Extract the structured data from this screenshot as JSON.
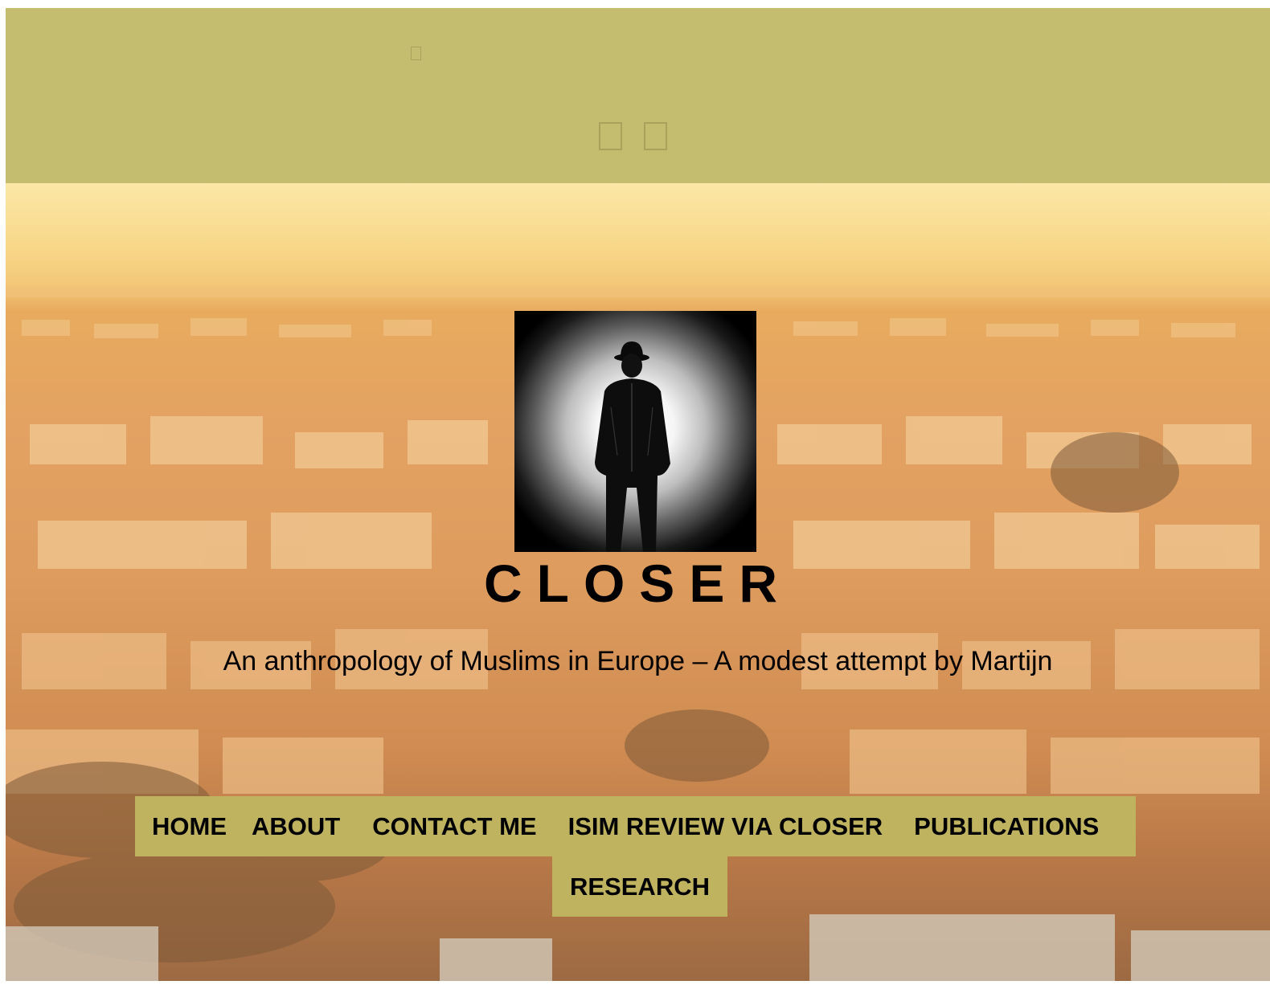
{
  "topbar": {
    "background": "#c4bd6f",
    "icons": [
      "missing-glyph-icon",
      "social-icon-1",
      "social-icon-2"
    ]
  },
  "hero": {
    "background": "sunset-city-photo",
    "logo": "man-in-bowler-hat-silhouette",
    "site_title": "CLOSER",
    "site_description": "An anthropology of Muslims in Europe – A modest attempt by Martijn"
  },
  "menu": {
    "background": "#bfb360",
    "items": [
      {
        "label": "HOME"
      },
      {
        "label": "ABOUT"
      },
      {
        "label": "CONTACT ME"
      },
      {
        "label": "ISIM REVIEW VIA CLOSER"
      },
      {
        "label": "PUBLICATIONS"
      },
      {
        "label": "RESEARCH"
      }
    ]
  }
}
